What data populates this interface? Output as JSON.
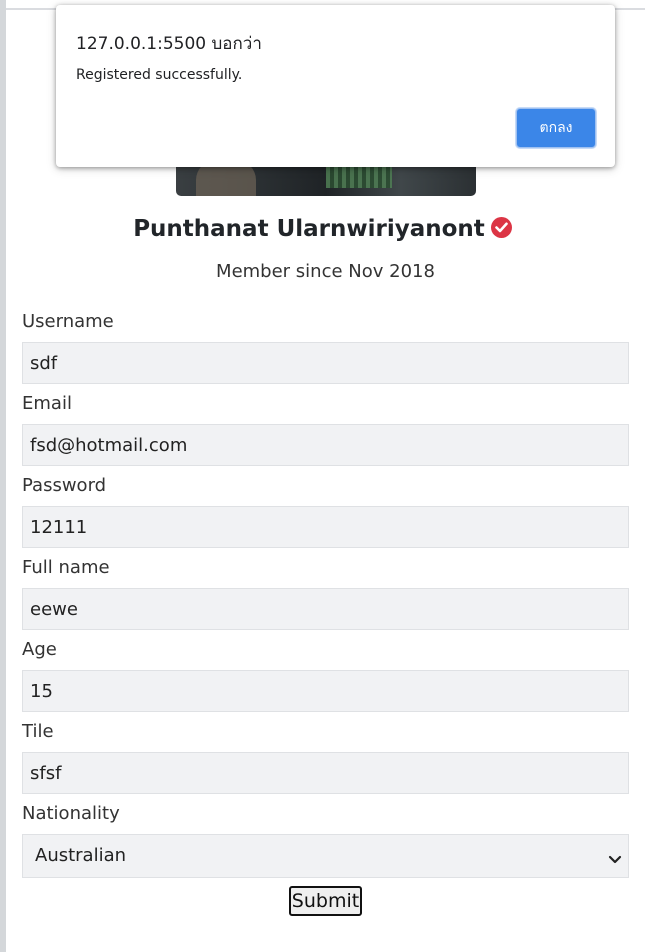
{
  "alert": {
    "origin": "127.0.0.1:5500 บอกว่า",
    "message": "Registered successfully.",
    "ok_label": "ตกลง"
  },
  "profile": {
    "name": "Punthanat Ularnwiriyanont",
    "member_since": "Member since Nov 2018",
    "verified_icon": "check-circle-icon",
    "verified_color": "#dc3545"
  },
  "form": {
    "fields": [
      {
        "label": "Username",
        "value": "sdf"
      },
      {
        "label": "Email",
        "value": "fsd@hotmail.com"
      },
      {
        "label": "Password",
        "value": "12111"
      },
      {
        "label": "Full name",
        "value": "eewe"
      },
      {
        "label": "Age",
        "value": "15"
      },
      {
        "label": "Tile",
        "value": "sfsf"
      }
    ],
    "nationality": {
      "label": "Nationality",
      "selected": "Australian"
    },
    "submit_label": "Submit"
  },
  "colors": {
    "alert_button": "#3b86e8",
    "input_bg": "#f1f2f4"
  }
}
